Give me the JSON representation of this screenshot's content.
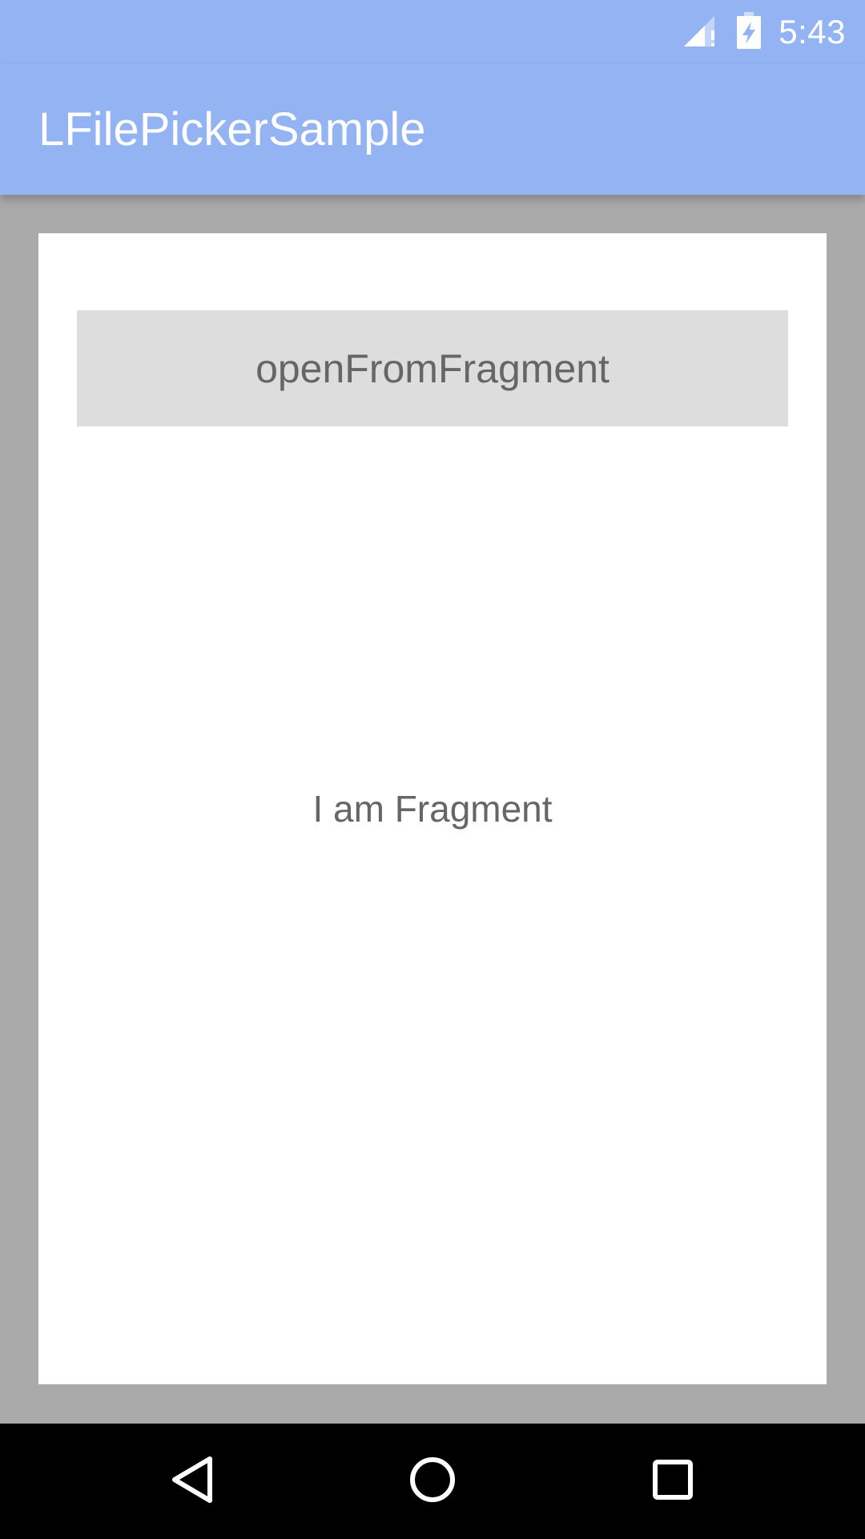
{
  "status_bar": {
    "time": "5:43",
    "icons": [
      "signal-icon",
      "battery-charging-icon"
    ]
  },
  "app_bar": {
    "title": "LFilePickerSample",
    "color": "#93b3f3"
  },
  "card": {
    "button_label": "openFromFragment",
    "fragment_text": "I am Fragment"
  },
  "nav_bar": {
    "icons": [
      "back-icon",
      "home-icon",
      "recent-apps-icon"
    ]
  },
  "colors": {
    "background": "#aaaaaa",
    "button": "#dddddd",
    "text": "#666666"
  }
}
